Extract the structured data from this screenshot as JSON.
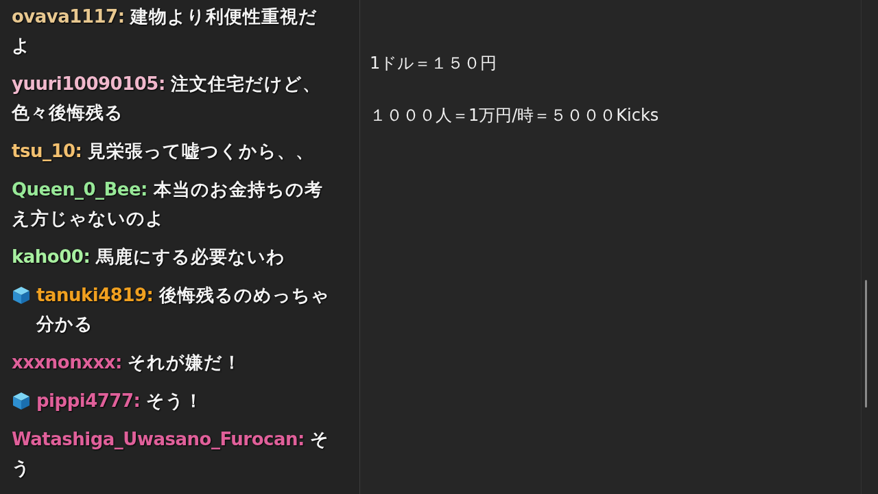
{
  "chat": {
    "messages": [
      {
        "user": "ovava1117:",
        "color": "#e8c890",
        "badge": false,
        "text": "建物より利便性重視だよ"
      },
      {
        "user": "yuuri10090105:",
        "color": "#f0b8cc",
        "badge": false,
        "text": "注文住宅だけど、色々後悔残る"
      },
      {
        "user": "tsu_10:",
        "color": "#f2c070",
        "badge": false,
        "text": "見栄張って嘘つくから、、"
      },
      {
        "user": "Queen_0_Bee:",
        "color": "#98e898",
        "badge": false,
        "text": "本当のお金持ちの考え方じゃないのよ"
      },
      {
        "user": "kaho00:",
        "color": "#a8f0a0",
        "badge": false,
        "text": "馬鹿にする必要ないわ"
      },
      {
        "user": "tanuki4819:",
        "color": "#f0a020",
        "badge": true,
        "text": "後悔残るのめっちゃ分かる"
      },
      {
        "user": "xxxnonxxx:",
        "color": "#e0609a",
        "badge": false,
        "text": "それが嫌だ！"
      },
      {
        "user": "pippi4777:",
        "color": "#e0609a",
        "badge": true,
        "text": "そう！"
      },
      {
        "user": "Watashiga_Uwasano_Furocan:",
        "color": "#e0609a",
        "badge": false,
        "text": "そう"
      }
    ]
  },
  "notes": {
    "lines": [
      "1ドル＝１５０円",
      "１０００人＝1万円/時＝５０００Kicks"
    ]
  }
}
